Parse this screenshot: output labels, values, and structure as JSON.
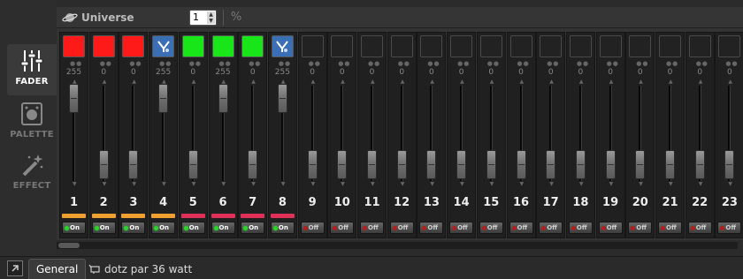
{
  "sidebar": {
    "items": [
      {
        "label": "FADER",
        "icon": "sliders-icon",
        "active": true
      },
      {
        "label": "PALETTE",
        "icon": "palette-icon",
        "active": false
      },
      {
        "label": "EFFECT",
        "icon": "magic-wand-icon",
        "active": false
      }
    ]
  },
  "toolbar": {
    "universe_label": "Universe",
    "universe_value": "1",
    "percent_label": "%"
  },
  "channels": [
    {
      "number": "1",
      "value": "255",
      "swatch": "#ff1a1a",
      "stripe": "#f0a030",
      "toggle": "On"
    },
    {
      "number": "2",
      "value": "0",
      "swatch": "#ff1a1a",
      "stripe": "#f0a030",
      "toggle": "On"
    },
    {
      "number": "3",
      "value": "0",
      "swatch": "#ff1a1a",
      "stripe": "#f0a030",
      "toggle": "On"
    },
    {
      "number": "4",
      "value": "255",
      "swatch": "icon",
      "stripe": "#f0a030",
      "toggle": "On"
    },
    {
      "number": "5",
      "value": "0",
      "swatch": "#19e619",
      "stripe": "#e0305a",
      "toggle": "On"
    },
    {
      "number": "6",
      "value": "255",
      "swatch": "#19e619",
      "stripe": "#e0305a",
      "toggle": "On"
    },
    {
      "number": "7",
      "value": "0",
      "swatch": "#19e619",
      "stripe": "#e0305a",
      "toggle": "On"
    },
    {
      "number": "8",
      "value": "255",
      "swatch": "icon",
      "stripe": "#e0305a",
      "toggle": "On"
    },
    {
      "number": "9",
      "value": "0",
      "swatch": "empty",
      "stripe": "",
      "toggle": "Off"
    },
    {
      "number": "10",
      "value": "0",
      "swatch": "empty",
      "stripe": "",
      "toggle": "Off"
    },
    {
      "number": "11",
      "value": "0",
      "swatch": "empty",
      "stripe": "",
      "toggle": "Off"
    },
    {
      "number": "12",
      "value": "0",
      "swatch": "empty",
      "stripe": "",
      "toggle": "Off"
    },
    {
      "number": "13",
      "value": "0",
      "swatch": "empty",
      "stripe": "",
      "toggle": "Off"
    },
    {
      "number": "14",
      "value": "0",
      "swatch": "empty",
      "stripe": "",
      "toggle": "Off"
    },
    {
      "number": "15",
      "value": "0",
      "swatch": "empty",
      "stripe": "",
      "toggle": "Off"
    },
    {
      "number": "16",
      "value": "0",
      "swatch": "empty",
      "stripe": "",
      "toggle": "Off"
    },
    {
      "number": "17",
      "value": "0",
      "swatch": "empty",
      "stripe": "",
      "toggle": "Off"
    },
    {
      "number": "18",
      "value": "0",
      "swatch": "empty",
      "stripe": "",
      "toggle": "Off"
    },
    {
      "number": "19",
      "value": "0",
      "swatch": "empty",
      "stripe": "",
      "toggle": "Off"
    },
    {
      "number": "20",
      "value": "0",
      "swatch": "empty",
      "stripe": "",
      "toggle": "Off"
    },
    {
      "number": "21",
      "value": "0",
      "swatch": "empty",
      "stripe": "",
      "toggle": "Off"
    },
    {
      "number": "22",
      "value": "0",
      "swatch": "empty",
      "stripe": "",
      "toggle": "Off"
    },
    {
      "number": "23",
      "value": "0",
      "swatch": "empty",
      "stripe": "",
      "toggle": "Off"
    }
  ],
  "tabs": [
    {
      "label": "General",
      "active": true
    },
    {
      "label": "dotz par 36 watt",
      "icon": "fixture-icon",
      "active": false
    }
  ]
}
